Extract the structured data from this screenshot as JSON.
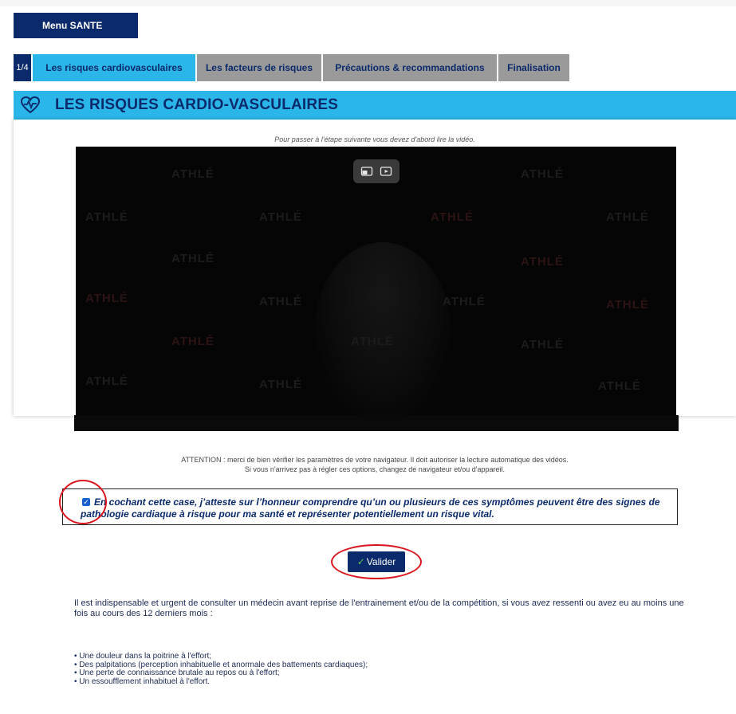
{
  "menu": {
    "label": "Menu SANTE"
  },
  "steps": {
    "badge": "1/4",
    "tabs": [
      {
        "label": "Les risques cardiovasculaires",
        "active": true
      },
      {
        "label": "Les facteurs de risques",
        "active": false
      },
      {
        "label": "Précautions & recommandations",
        "active": false
      },
      {
        "label": "Finalisation",
        "active": false
      }
    ]
  },
  "section": {
    "title": "LES RISQUES CARDIO-VASCULAIRES",
    "icon": "heart-pulse-icon"
  },
  "video": {
    "note": "Pour passer à l'étape suivante vous devez d'abord lire la vidéo.",
    "watermark": "ATHLÉ",
    "controls": [
      "picture-in-picture-icon",
      "cast-video-icon"
    ]
  },
  "attention": {
    "line1": "ATTENTION : merci de bien vérifier les paramètres de votre navigateur. Il doit autoriser la lecture automatique des vidéos.",
    "line2": "Si vous n'arrivez pas à régler ces options, changez de navigateur et/ou d'appareil."
  },
  "consent": {
    "checked": true,
    "text": "En cochant cette case, j’atteste sur l’honneur comprendre qu’un ou plusieurs de ces symptômes peuvent être des signes de pathologie cardiaque à risque pour ma santé et représenter potentiellement un risque vital."
  },
  "validate": {
    "label": "Valider"
  },
  "info": {
    "text": "Il est indispensable et urgent de consulter un médecin avant reprise de l'entrainement et/ou de la compétition, si vous avez ressenti ou avez eu au moins une fois au cours des 12 derniers mois :",
    "symptoms": [
      "• Une douleur dans la poitrine à l'effort;",
      "• Des palpitations (perception inhabituelle et anormale des battements cardiaques);",
      "• Une perte de connaissance brutale au repos ou à l'effort;",
      "• Un essoufflement inhabituel à l'effort."
    ]
  },
  "colors": {
    "navy": "#0b2a6b",
    "cyan": "#2bb6ea",
    "annotation": "#d8141c"
  }
}
